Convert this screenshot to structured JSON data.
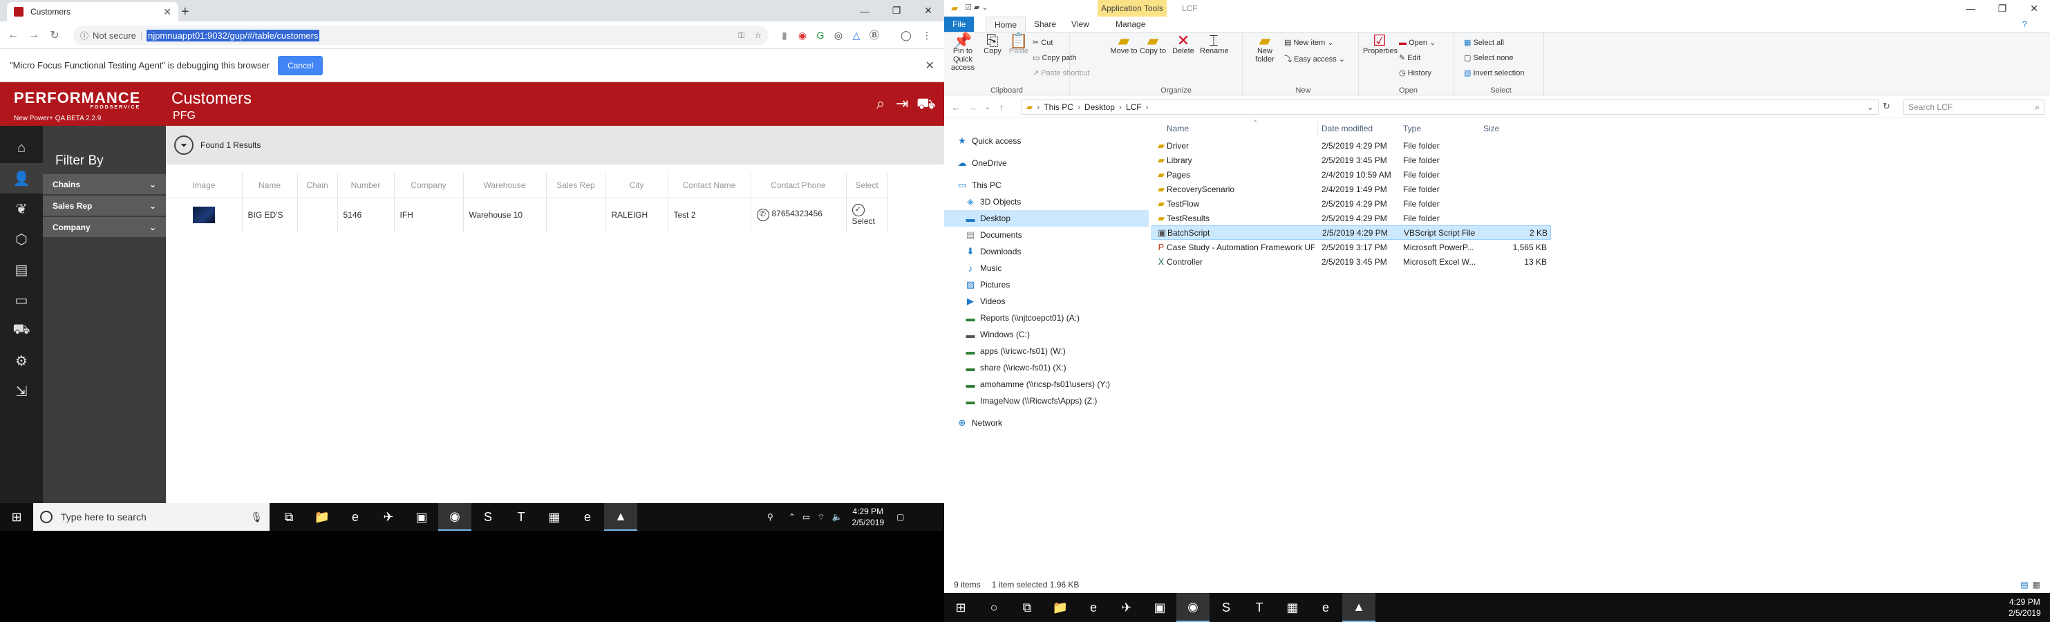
{
  "chrome": {
    "tab_title": "Customers",
    "new_tab": "+",
    "not_secure": "Not secure",
    "url": "njpmnuappt01:9032/gup/#/table/customers",
    "infobar_text": "\"Micro Focus Functional Testing Agent\" is debugging this browser",
    "infobar_button": "Cancel"
  },
  "app": {
    "logo": "PERFORMANCE",
    "logo_sub": "FOODSERVICE",
    "version": "New Power+ QA BETA 2.2.9",
    "page_title": "Customers",
    "page_subtitle": "PFG",
    "filter_title": "Filter By",
    "filters": [
      "Chains",
      "Sales Rep",
      "Company"
    ],
    "found_text": "Found 1 Results",
    "columns": [
      "Image",
      "Name",
      "Chain",
      "Number",
      "Company",
      "Warehouse",
      "Sales Rep",
      "City",
      "Contact Name",
      "Contact Phone",
      "Select"
    ],
    "rows": [
      {
        "name": "BIG ED'S",
        "chain": "",
        "number": "5146",
        "company": "IFH",
        "warehouse": "Warehouse 10",
        "sales_rep": "",
        "city": "RALEIGH",
        "contact_name": "Test 2",
        "contact_phone": "87654323456",
        "select": "Select"
      }
    ]
  },
  "taskbar_left": {
    "search_placeholder": "Type here to search",
    "time": "4:29 PM",
    "date": "2/5/2019"
  },
  "explorer": {
    "app_tools": "Application Tools",
    "window_title": "LCF",
    "tabs": [
      "File",
      "Home",
      "Share",
      "View",
      "Manage"
    ],
    "ribbon": {
      "pin": "Pin to Quick access",
      "copy": "Copy",
      "paste": "Paste",
      "cut": "Cut",
      "copy_path": "Copy path",
      "paste_shortcut": "Paste shortcut",
      "clipboard": "Clipboard",
      "move_to": "Move to",
      "copy_to": "Copy to",
      "delete": "Delete",
      "rename": "Rename",
      "organize": "Organize",
      "new_folder": "New folder",
      "new_item": "New item",
      "easy_access": "Easy access",
      "new": "New",
      "properties": "Properties",
      "open": "Open",
      "edit": "Edit",
      "history": "History",
      "open_group": "Open",
      "select_all": "Select all",
      "select_none": "Select none",
      "invert_selection": "Invert selection",
      "select": "Select"
    },
    "breadcrumb": [
      "This PC",
      "Desktop",
      "LCF"
    ],
    "search_placeholder": "Search LCF",
    "nav": [
      "Quick access",
      "OneDrive",
      "This PC",
      "3D Objects",
      "Desktop",
      "Documents",
      "Downloads",
      "Music",
      "Pictures",
      "Videos",
      "Reports (\\\\njtcoepct01) (A:)",
      "Windows (C:)",
      "apps (\\\\ricwc-fs01) (W:)",
      "share (\\\\ricwc-fs01) (X:)",
      "amohamme (\\\\ricsp-fs01\\users) (Y:)",
      "ImageNow (\\\\Ricwcfs\\Apps) (Z:)",
      "Network"
    ],
    "columns": [
      "Name",
      "Date modified",
      "Type",
      "Size"
    ],
    "files": [
      {
        "name": "Driver",
        "date": "2/5/2019 4:29 PM",
        "type": "File folder",
        "size": ""
      },
      {
        "name": "Library",
        "date": "2/5/2019 3:45 PM",
        "type": "File folder",
        "size": ""
      },
      {
        "name": "Pages",
        "date": "2/4/2019 10:59 AM",
        "type": "File folder",
        "size": ""
      },
      {
        "name": "RecoveryScenario",
        "date": "2/4/2019 1:49 PM",
        "type": "File folder",
        "size": ""
      },
      {
        "name": "TestFlow",
        "date": "2/5/2019 4:29 PM",
        "type": "File folder",
        "size": ""
      },
      {
        "name": "TestResults",
        "date": "2/5/2019 4:29 PM",
        "type": "File folder",
        "size": ""
      },
      {
        "name": "BatchScript",
        "date": "2/5/2019 4:29 PM",
        "type": "VBScript Script File",
        "size": "2 KB"
      },
      {
        "name": "Case Study - Automation Framework UF...",
        "date": "2/5/2019 3:17 PM",
        "type": "Microsoft PowerP...",
        "size": "1,565 KB"
      },
      {
        "name": "Controller",
        "date": "2/5/2019 3:45 PM",
        "type": "Microsoft Excel W...",
        "size": "13 KB"
      }
    ],
    "status_items": "9 items",
    "status_selected": "1 item selected  1.96 KB"
  },
  "taskbar_right": {
    "time": "4:29 PM",
    "date": "2/5/2019"
  }
}
